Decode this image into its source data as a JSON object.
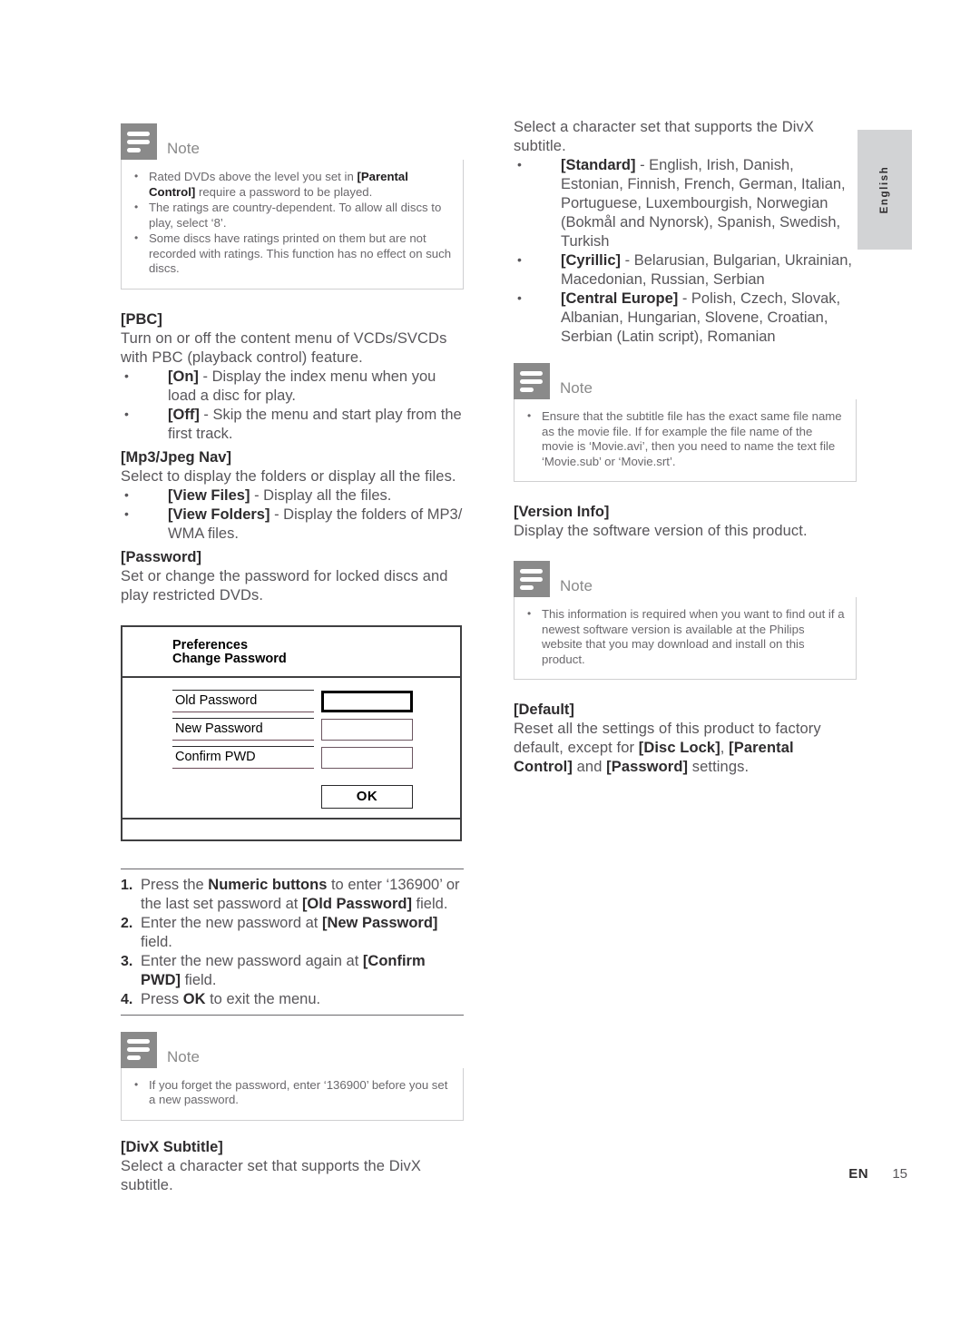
{
  "page": {
    "footer_label": "EN",
    "footer_page": "15",
    "language_tab": "English"
  },
  "note_icon_name": "note-lines-icon",
  "left_column": {
    "note_top": {
      "title": "Note",
      "items": [
        "Rated DVDs above the level you set in <b>[Parental Control]</b> require a password to be played.",
        "The ratings are country-dependent. To allow all discs to play, select ‘8’.",
        "Some discs have ratings printed on them but are not recorded with ratings. This function has no effect on such discs."
      ]
    },
    "pbc": {
      "heading": "[PBC]",
      "intro": "Turn on or off the content menu of VCDs/SVCDs with PBC (playback control) feature.",
      "bullets": [
        "<b>[On]</b> - Display the index menu when you load a disc for play.",
        "<b>[Off]</b> - Skip the menu and start play from the first track."
      ]
    },
    "mp3jpeg": {
      "heading": "[Mp3/Jpeg Nav]",
      "intro": "Select to display the folders or display all the files.",
      "bullets": [
        "<b>[View Files]</b> - Display all the files.",
        "<b>[View Folders]</b> - Display the folders of MP3/ WMA files."
      ]
    },
    "password": {
      "heading": "[Password]",
      "intro": "Set or change the password for locked discs and play restricted DVDs."
    },
    "osd": {
      "title_line1": "Preferences",
      "title_line2": "Change Password",
      "rows": [
        {
          "label": "Old Password",
          "value": "",
          "focused": true
        },
        {
          "label": "New Password",
          "value": "",
          "focused": false
        },
        {
          "label": "Confirm PWD",
          "value": "",
          "focused": false
        }
      ],
      "ok_label": "OK"
    },
    "steps": [
      "Press the <b>Numeric buttons</b> to enter ‘136900’ or the last set password at <b>[Old Password]</b> field.",
      "Enter the new password at <b>[New Password]</b> field.",
      "Enter the new password again at <b>[Confirm PWD]</b> field.",
      "Press <b>OK</b> to exit the menu."
    ],
    "note_bottom": {
      "title": "Note",
      "items": [
        "If you forget the password, enter ‘136900’ before you set a new password."
      ]
    },
    "divx": {
      "heading": "[DivX Subtitle]",
      "intro": "Select a character set that supports the DivX subtitle."
    }
  },
  "right_column": {
    "divx_intro": "Select a character set that supports the DivX subtitle.",
    "divx_bullets": [
      "<b>[Standard]</b> - English, Irish, Danish, Estonian, Finnish, French, German, Italian, Portuguese, Luxembourgish, Norwegian (Bokmål and Nynorsk), Spanish, Swedish, Turkish",
      "<b>[Cyrillic]</b> - Belarusian, Bulgarian, Ukrainian, Macedonian, Russian, Serbian",
      "<b>[Central Europe]</b> - Polish, Czech, Slovak, Albanian, Hungarian, Slovene, Croatian, Serbian (Latin script), Romanian"
    ],
    "note_subtitle": {
      "title": "Note",
      "items": [
        "Ensure that the subtitle file has the exact same file name as the movie file. If for example the file name of the movie is ‘Movie.avi’, then you need to name the text file ‘Movie.sub’ or ‘Movie.srt’."
      ]
    },
    "version_info": {
      "heading": "[Version Info]",
      "intro": "Display the software version of this product."
    },
    "note_version": {
      "title": "Note",
      "items": [
        "This information is required when you want to find out if a newest software version is available at the Philips website that you may download and install on this product."
      ]
    },
    "default": {
      "heading": "[Default]",
      "intro": "Reset all the settings of this product to factory default, except for <b>[Disc Lock]</b>, <b>[Parental Control]</b> and <b>[Password]</b> settings."
    }
  }
}
